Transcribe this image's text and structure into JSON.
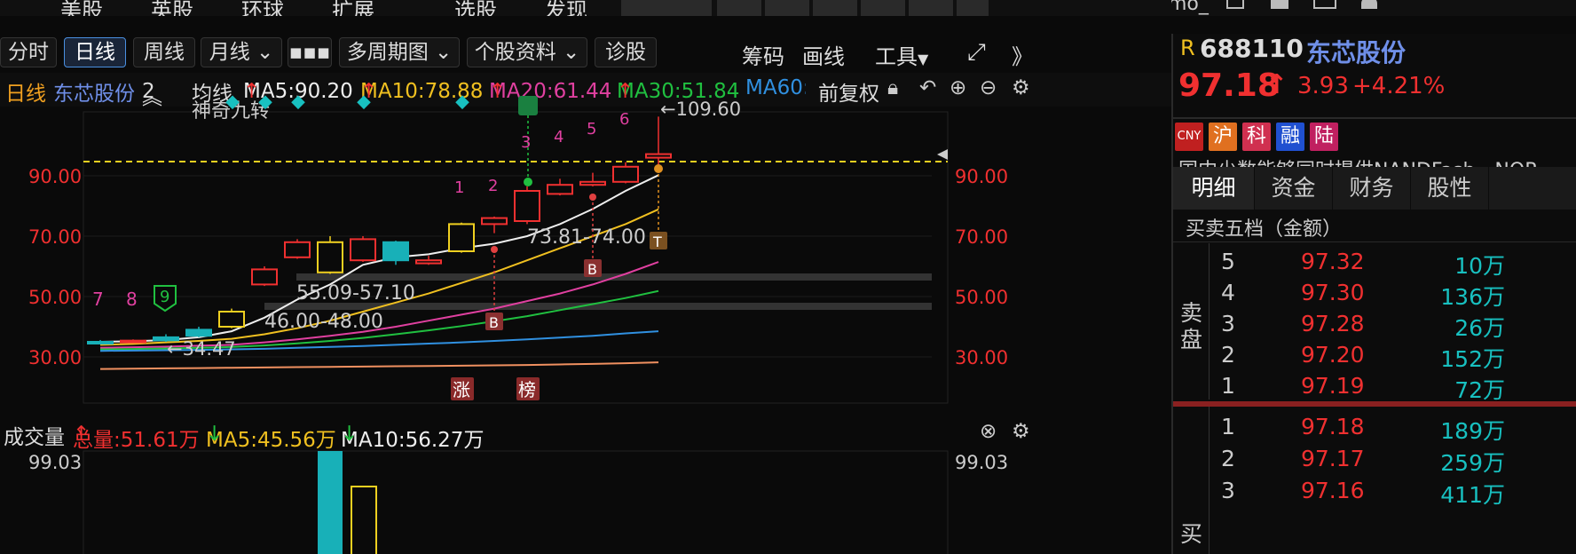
{
  "top_nav": {
    "items": [
      "美股",
      "英股",
      "环球",
      "扩展",
      "选股",
      "发现"
    ],
    "user": "mo_"
  },
  "toolbar": {
    "buttons": [
      "分时",
      "日线",
      "周线",
      "月线",
      "▪▪▪",
      "多周期图",
      "个股资料",
      "诊股"
    ],
    "right": [
      "筹码",
      "画线",
      "工具"
    ]
  },
  "ma_bar": {
    "period": "日线",
    "stock": "东芯股份",
    "count": "2",
    "label": "均线",
    "ma5": "MA5:90.20",
    "ma10": "MA10:78.88",
    "ma20": "MA20:61.44",
    "ma30": "MA30:51.84",
    "ma60": "MA60:",
    "adjust": "前复权"
  },
  "chart_labels": {
    "indicator": "神奇九转",
    "high": "←109.60",
    "low": "←34.47",
    "range1": "73.81-74.00",
    "range2": "55.09-57.10",
    "range3": "46.00-48.00",
    "seq_left": [
      "7",
      "8",
      "9"
    ],
    "seq_right": [
      "1",
      "2",
      "3",
      "4",
      "5",
      "6"
    ],
    "marker_b": "B",
    "marker_t": "T",
    "tag_zhang": "涨",
    "tag_bang": "榜"
  },
  "volume_bar": {
    "label": "成交量",
    "total": "总量:51.61万",
    "ma5": "MA5:45.56万",
    "ma10": "MA10:56.27万",
    "axis": "99.03"
  },
  "chart_data": {
    "type": "candlestick",
    "y_ticks": [
      "90.00",
      "70.00",
      "50.00",
      "30.00"
    ],
    "y_range": [
      22,
      112
    ],
    "candles": [
      {
        "o": 35,
        "c": 35,
        "h": 35.6,
        "l": 34.5,
        "up": false
      },
      {
        "o": 35.2,
        "c": 35.4,
        "h": 35.8,
        "l": 34.8,
        "up": true
      },
      {
        "o": 35.5,
        "c": 36.5,
        "h": 37.5,
        "l": 35,
        "up": false
      },
      {
        "o": 37,
        "c": 39,
        "h": 40,
        "l": 36.5,
        "up": false
      },
      {
        "o": 40,
        "c": 45,
        "h": 46,
        "l": 39.5,
        "up": true
      },
      {
        "o": 54,
        "c": 59,
        "h": 60,
        "l": 53.5,
        "up": true
      },
      {
        "o": 63,
        "c": 68,
        "h": 69,
        "l": 62.5,
        "up": true
      },
      {
        "o": 58,
        "c": 68,
        "h": 70,
        "l": 57.5,
        "up": false
      },
      {
        "o": 62,
        "c": 69,
        "h": 70,
        "l": 61.5,
        "up": true
      },
      {
        "o": 62,
        "c": 68,
        "h": 68.5,
        "l": 60.5,
        "up": false
      },
      {
        "o": 61,
        "c": 62,
        "h": 63.5,
        "l": 60.5,
        "up": true
      },
      {
        "o": 65,
        "c": 74,
        "h": 74.5,
        "l": 64.5,
        "up": true
      },
      {
        "o": 74,
        "c": 76,
        "h": 76.5,
        "l": 71,
        "up": true
      },
      {
        "o": 75,
        "c": 85,
        "h": 86.5,
        "l": 74,
        "up": true
      },
      {
        "o": 84,
        "c": 87,
        "h": 89,
        "l": 83.5,
        "up": true
      },
      {
        "o": 87,
        "c": 88,
        "h": 91,
        "l": 86.5,
        "up": true
      },
      {
        "o": 88,
        "c": 93,
        "h": 94.5,
        "l": 87.5,
        "up": true
      },
      {
        "o": 96,
        "c": 97.18,
        "h": 109.6,
        "l": 91.5,
        "up": true
      }
    ],
    "ma": [
      {
        "name": "MA5",
        "color": "#eeeeee",
        "values": [
          35,
          35.2,
          35.6,
          36.5,
          38.5,
          43,
          49,
          54,
          60.5,
          63,
          64,
          66,
          67.5,
          70,
          74,
          79,
          85,
          90.2
        ]
      },
      {
        "name": "MA10",
        "color": "#f0c020",
        "values": [
          34,
          34.3,
          34.8,
          35.3,
          36,
          37.5,
          39.5,
          42,
          45,
          48,
          51,
          54.5,
          58,
          62,
          66,
          70,
          74,
          78.88
        ]
      },
      {
        "name": "MA20",
        "color": "#e040a0",
        "values": [
          33,
          33.2,
          33.4,
          33.7,
          34,
          34.8,
          35.8,
          37,
          38.3,
          40,
          42,
          44,
          46,
          48.5,
          51,
          54,
          57.5,
          61.44
        ]
      },
      {
        "name": "MA30",
        "color": "#20c040",
        "values": [
          32.5,
          32.6,
          32.8,
          33,
          33.3,
          33.8,
          34.5,
          35.3,
          36.3,
          37.5,
          38.8,
          40.2,
          41.8,
          43.5,
          45.5,
          47.5,
          49.5,
          51.84
        ]
      },
      {
        "name": "MA60",
        "color": "#3090e0",
        "values": [
          32,
          32.1,
          32.2,
          32.3,
          32.5,
          32.7,
          33,
          33.3,
          33.6,
          34,
          34.4,
          34.8,
          35.3,
          35.8,
          36.4,
          37,
          37.8,
          38.5
        ]
      },
      {
        "name": "MA120",
        "color": "#f09060",
        "values": [
          26,
          26.1,
          26.2,
          26.3,
          26.4,
          26.5,
          26.6,
          26.7,
          26.8,
          26.9,
          27,
          27.1,
          27.2,
          27.3,
          27.5,
          27.7,
          27.9,
          28.2
        ]
      }
    ]
  },
  "right_panel": {
    "market": "R",
    "code": "688110",
    "name": "东芯股份",
    "price": "97.18",
    "arrow": "↑",
    "change": "3.93",
    "change_pct": "+4.21%",
    "badges": [
      "CNY",
      "沪",
      "科",
      "融",
      "陆"
    ],
    "description": "国内少数能够同时提供NANDFash、NOR",
    "tabs": [
      "明细",
      "资金",
      "财务",
      "股性"
    ],
    "orderbook_title": "买卖五档（金额）",
    "sell_label": "卖盘",
    "buy_label": "买",
    "sell": [
      {
        "level": "5",
        "price": "97.32",
        "amount": "10万"
      },
      {
        "level": "4",
        "price": "97.30",
        "amount": "136万"
      },
      {
        "level": "3",
        "price": "97.28",
        "amount": "26万"
      },
      {
        "level": "2",
        "price": "97.20",
        "amount": "152万"
      },
      {
        "level": "1",
        "price": "97.19",
        "amount": "72万"
      }
    ],
    "buy": [
      {
        "level": "1",
        "price": "97.18",
        "amount": "189万"
      },
      {
        "level": "2",
        "price": "97.17",
        "amount": "259万"
      },
      {
        "level": "3",
        "price": "97.16",
        "amount": "411万"
      }
    ]
  }
}
